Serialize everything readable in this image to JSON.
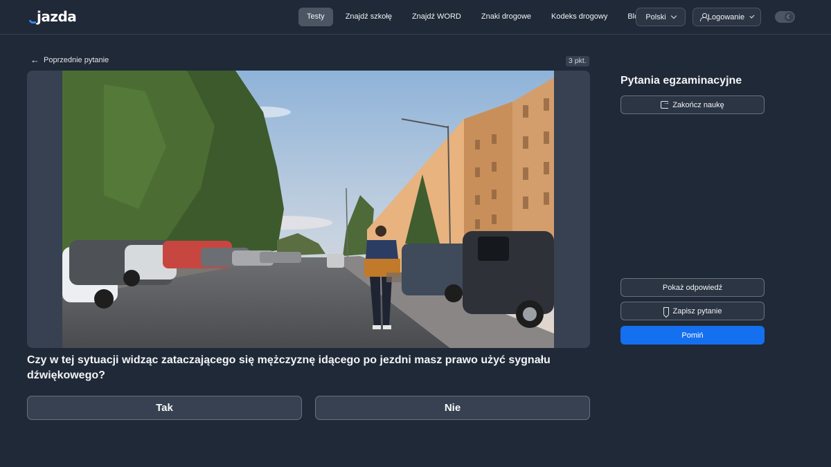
{
  "header": {
    "logo": "jazda",
    "nav": [
      "Testy",
      "Znajdź szkołę",
      "Znajdź WORD",
      "Znaki drogowe",
      "Kodeks drogowy",
      "Blog"
    ],
    "language": "Polski",
    "login": "Logowanie",
    "theme_icon": "moon-icon"
  },
  "question_panel": {
    "prev_label": "Poprzednie pytanie",
    "points": "3 pkt.",
    "question": "Czy w tej sytuacji widząc zataczającego się mężczyznę idącego po jezdni masz prawo użyć sygnału dźwiękowego?",
    "answers": [
      "Tak",
      "Nie"
    ]
  },
  "sidebar": {
    "title": "Pytania egzaminacyjne",
    "end_label": "Zakończ naukę",
    "show_answer_label": "Pokaż odpowiedź",
    "save_label": "Zapisz pytanie",
    "skip_label": "Pomiń"
  },
  "colors": {
    "background": "#1f2937",
    "accent": "#1570ef",
    "panel": "#374151"
  }
}
